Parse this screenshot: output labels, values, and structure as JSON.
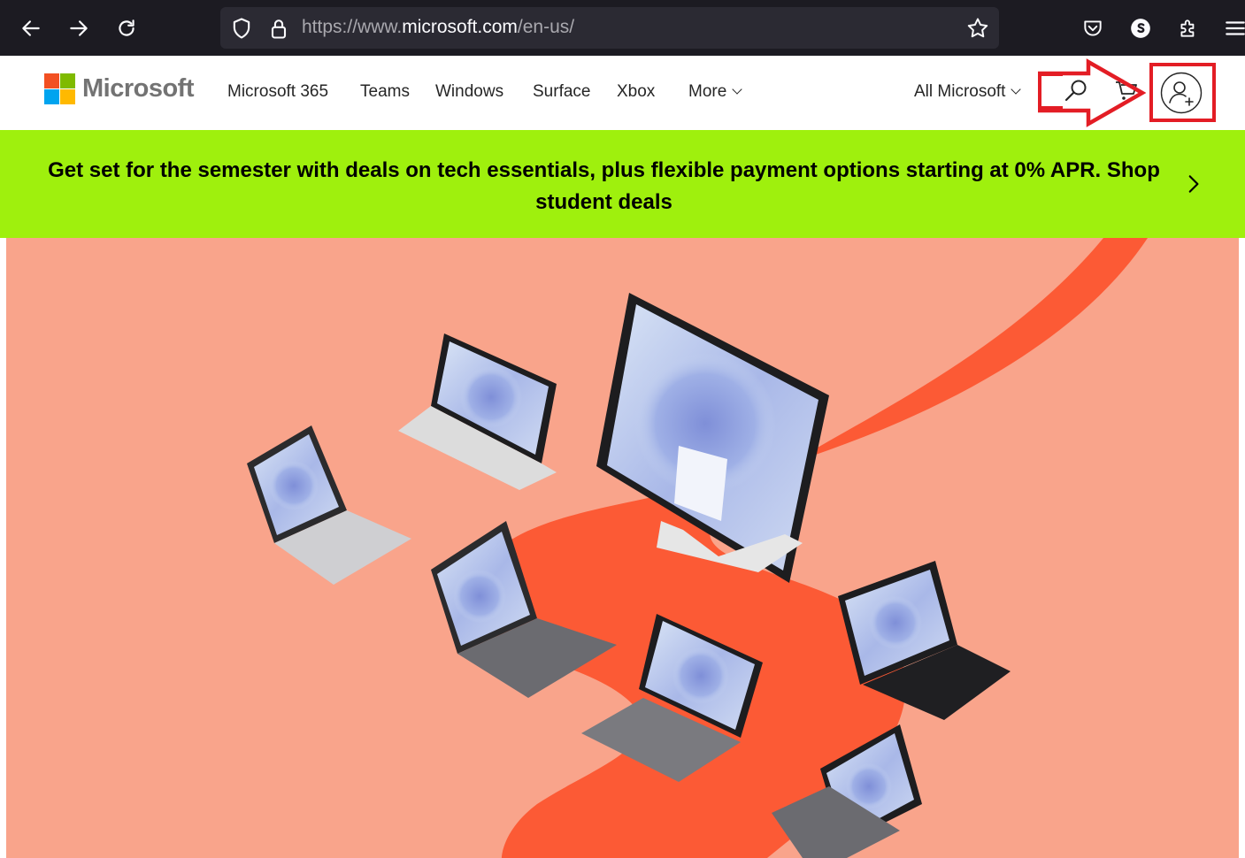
{
  "browser": {
    "url_prefix": "https://www.",
    "url_domain": "microsoft.com",
    "url_path": "/en-us/",
    "icons": {
      "back": "back-arrow-icon",
      "forward": "forward-arrow-icon",
      "reload": "reload-icon",
      "shield": "tracking-protection-shield-icon",
      "lock": "lock-icon",
      "bookmark": "bookmark-star-icon",
      "pocket": "pocket-icon",
      "account": "firefox-account-icon",
      "extensions": "extensions-puzzle-icon",
      "menu": "hamburger-menu-icon"
    }
  },
  "header": {
    "logo_text": "Microsoft",
    "logo_colors": [
      "#f25022",
      "#7fba00",
      "#00a4ef",
      "#ffb900"
    ],
    "nav": [
      {
        "label": "Microsoft 365"
      },
      {
        "label": "Teams"
      },
      {
        "label": "Windows"
      },
      {
        "label": "Surface"
      },
      {
        "label": "Xbox"
      },
      {
        "label": "More"
      }
    ],
    "all_microsoft": "All Microsoft",
    "icons": {
      "search": "search-icon",
      "cart": "shopping-cart-icon",
      "account": "add-account-icon"
    }
  },
  "banner": {
    "text": "Get set for the semester with deals on tech essentials, plus flexible payment options starting at 0% APR. Shop student deals",
    "bg_color": "#9ff00d"
  },
  "hero": {
    "bg_color": "#f9a48b",
    "accent_color": "#fc5a35"
  },
  "annotation": {
    "color": "#e31d25"
  }
}
